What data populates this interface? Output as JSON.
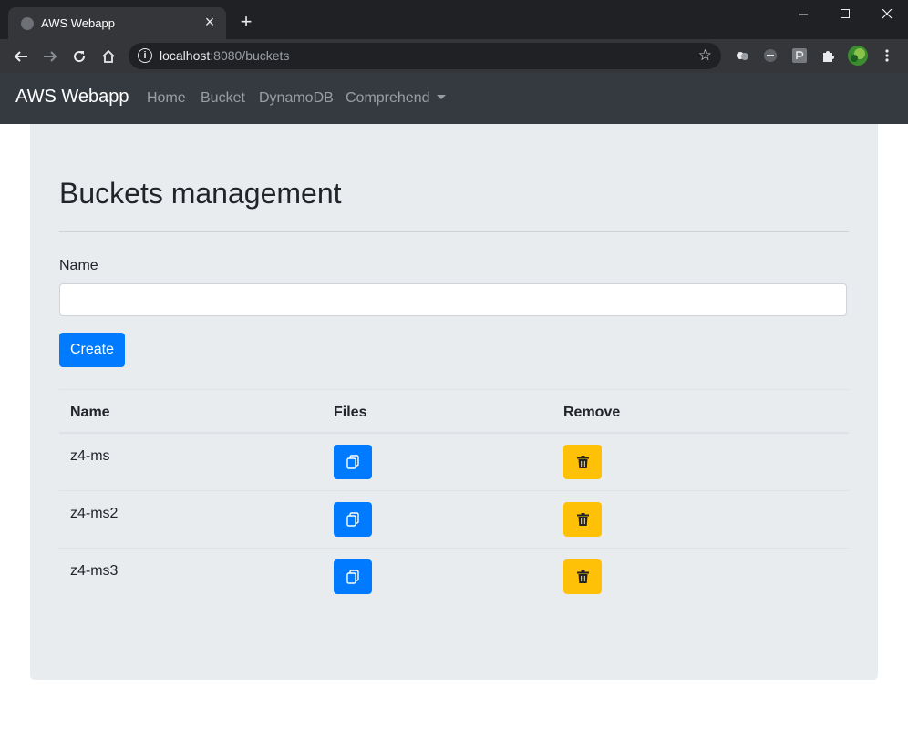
{
  "browser": {
    "tab_title": "AWS Webapp",
    "tab_close": "×",
    "new_tab": "+",
    "url_host": "localhost",
    "url_path": ":8080/buckets"
  },
  "navbar": {
    "brand": "AWS Webapp",
    "links": [
      "Home",
      "Bucket",
      "DynamoDB",
      "Comprehend"
    ]
  },
  "main": {
    "title": "Buckets management",
    "name_label": "Name",
    "name_value": "",
    "create_label": "Create",
    "table": {
      "headers": [
        "Name",
        "Files",
        "Remove"
      ],
      "rows": [
        {
          "name": "z4-ms"
        },
        {
          "name": "z4-ms2"
        },
        {
          "name": "z4-ms3"
        }
      ]
    }
  },
  "colors": {
    "primary": "#007bff",
    "warning": "#ffc107",
    "navbar": "#343a40",
    "jumbotron": "#e9ecef"
  },
  "icons": {
    "files": "files-icon",
    "remove": "trash-icon"
  }
}
